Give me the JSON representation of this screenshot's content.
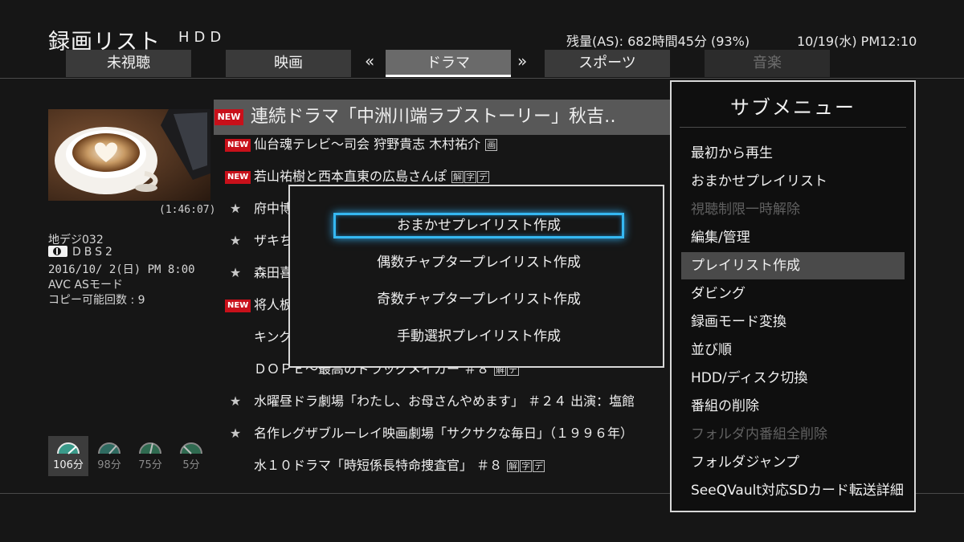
{
  "header": {
    "title": "録画リスト",
    "source": "HDD",
    "remaining": "残量(AS): 682時間45分 (93%)",
    "datetime": "10/19(水) PM12:10"
  },
  "tabs": [
    {
      "label": "未視聴",
      "state": "normal"
    },
    {
      "label": "映画",
      "state": "normal"
    },
    {
      "label": "ドラマ",
      "state": "active"
    },
    {
      "label": "スポーツ",
      "state": "normal"
    },
    {
      "label": "音楽",
      "state": "dim"
    }
  ],
  "tab_arrows": {
    "left": "«",
    "right": "»"
  },
  "program_info": {
    "duration": "(1:46:07)",
    "channel": "地デジ032",
    "station": "DBS2",
    "air_date": "2016/10/ 2(日) PM 8:00",
    "mode": "AVC ASモード",
    "copies": "コピー可能回数 : 9"
  },
  "gauges": [
    {
      "label": "106分",
      "selected": true,
      "color": "#3a9a8a"
    },
    {
      "label": "98分",
      "selected": false,
      "color": "#2f6a60"
    },
    {
      "label": "75分",
      "selected": false,
      "color": "#2f6a50"
    },
    {
      "label": "5分",
      "selected": false,
      "color": "#2f6a50"
    }
  ],
  "recordings": [
    {
      "mark": "NEW",
      "title": "連続ドラマ「中洲川端ラブストーリー」秋吉‥",
      "tags": []
    },
    {
      "mark": "NEW",
      "title": "仙台魂テレビ～司会 狩野貴志 木村祐介",
      "tags": [
        "画"
      ]
    },
    {
      "mark": "NEW",
      "title": "若山祐樹と西本直東の広島さんぽ",
      "tags": [
        "解",
        "字",
        "デ"
      ]
    },
    {
      "mark": "★",
      "title": "府中博",
      "tags": []
    },
    {
      "mark": "★",
      "title": "ザキち",
      "tags": []
    },
    {
      "mark": "★",
      "title": "森田喜",
      "tags": []
    },
    {
      "mark": "NEW",
      "title": "将人板",
      "tags": []
    },
    {
      "mark": "",
      "title": "キング",
      "tags": []
    },
    {
      "mark": "",
      "title": "ＤＯＰＥ～最高のドラッグメイカー ＃８",
      "tags": [
        "解",
        "デ"
      ]
    },
    {
      "mark": "★",
      "title": "水曜昼ドラ劇場「わたし、お母さんやめます」 ＃２４ 出演：塩館",
      "tags": []
    },
    {
      "mark": "★",
      "title": "名作レグザブルーレイ映画劇場「サクサクな毎日」（１９９６年）",
      "tags": []
    },
    {
      "mark": "",
      "title": "水１０ドラマ「時短係長特命捜査官」 ＃８",
      "tags": [
        "解",
        "字",
        "デ"
      ]
    }
  ],
  "dialog": {
    "items": [
      {
        "label": "おまかせプレイリスト作成",
        "focused": true
      },
      {
        "label": "偶数チャプタープレイリスト作成",
        "focused": false
      },
      {
        "label": "奇数チャプタープレイリスト作成",
        "focused": false
      },
      {
        "label": "手動選択プレイリスト作成",
        "focused": false
      }
    ]
  },
  "submenu": {
    "title": "サブメニュー",
    "items": [
      {
        "label": "最初から再生",
        "state": "normal"
      },
      {
        "label": "おまかせプレイリスト",
        "state": "normal"
      },
      {
        "label": "視聴制限一時解除",
        "state": "dim"
      },
      {
        "label": "編集/管理",
        "state": "normal"
      },
      {
        "label": "プレイリスト作成",
        "state": "selected"
      },
      {
        "label": "ダビング",
        "state": "normal"
      },
      {
        "label": "録画モード変換",
        "state": "normal"
      },
      {
        "label": "並び順",
        "state": "normal"
      },
      {
        "label": "HDD/ディスク切換",
        "state": "normal"
      },
      {
        "label": "番組の削除",
        "state": "normal"
      },
      {
        "label": "フォルダ内番組全削除",
        "state": "dim"
      },
      {
        "label": "フォルダジャンプ",
        "state": "normal"
      },
      {
        "label": "SeeQVault対応SDカード転送詳細",
        "state": "normal"
      }
    ]
  }
}
